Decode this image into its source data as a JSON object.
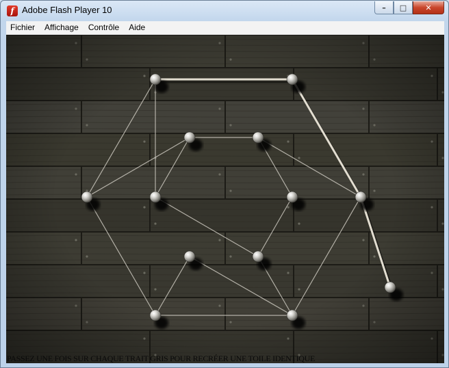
{
  "window": {
    "title": "Adobe Flash Player 10",
    "icon": "flash-player-icon"
  },
  "window_controls": {
    "minimize": "minimize-icon",
    "maximize": "maximize-icon",
    "close": "close-icon"
  },
  "menu": [
    {
      "id": "fichier",
      "label": "Fichier"
    },
    {
      "id": "affichage",
      "label": "Affichage"
    },
    {
      "id": "controle",
      "label": "Contrôle"
    },
    {
      "id": "aide",
      "label": "Aide"
    }
  ],
  "game": {
    "instruction": "PASSEZ UNE FOIS SUR CHAQUE TRAIT GRIS POUR RECRÉER UNE TOILE IDENTIQUE",
    "pins": [
      {
        "id": "p1"
      },
      {
        "id": "p2"
      },
      {
        "id": "p3"
      },
      {
        "id": "p4"
      },
      {
        "id": "p5"
      },
      {
        "id": "p6"
      },
      {
        "id": "p7"
      },
      {
        "id": "p8"
      },
      {
        "id": "p9"
      },
      {
        "id": "p10"
      },
      {
        "id": "p11"
      },
      {
        "id": "p12"
      },
      {
        "id": "p13"
      }
    ],
    "grey_threads": [
      [
        "p1",
        "p5"
      ],
      [
        "p1",
        "p6"
      ],
      [
        "p2",
        "p8"
      ],
      [
        "p3",
        "p4"
      ],
      [
        "p3",
        "p5"
      ],
      [
        "p3",
        "p6"
      ],
      [
        "p4",
        "p7"
      ],
      [
        "p4",
        "p8"
      ],
      [
        "p5",
        "p11"
      ],
      [
        "p6",
        "p10"
      ],
      [
        "p7",
        "p10"
      ],
      [
        "p8",
        "p12"
      ],
      [
        "p9",
        "p11"
      ],
      [
        "p9",
        "p12"
      ],
      [
        "p10",
        "p12"
      ],
      [
        "p11",
        "p12"
      ]
    ],
    "drawn_threads": [
      [
        "p1",
        "p2"
      ],
      [
        "p2",
        "p8"
      ],
      [
        "p8",
        "p13"
      ]
    ],
    "colors": {
      "grey_thread": "#c9c6bc",
      "drawn_thread": "#e2ddd0",
      "wood": "#3c3b33"
    }
  }
}
